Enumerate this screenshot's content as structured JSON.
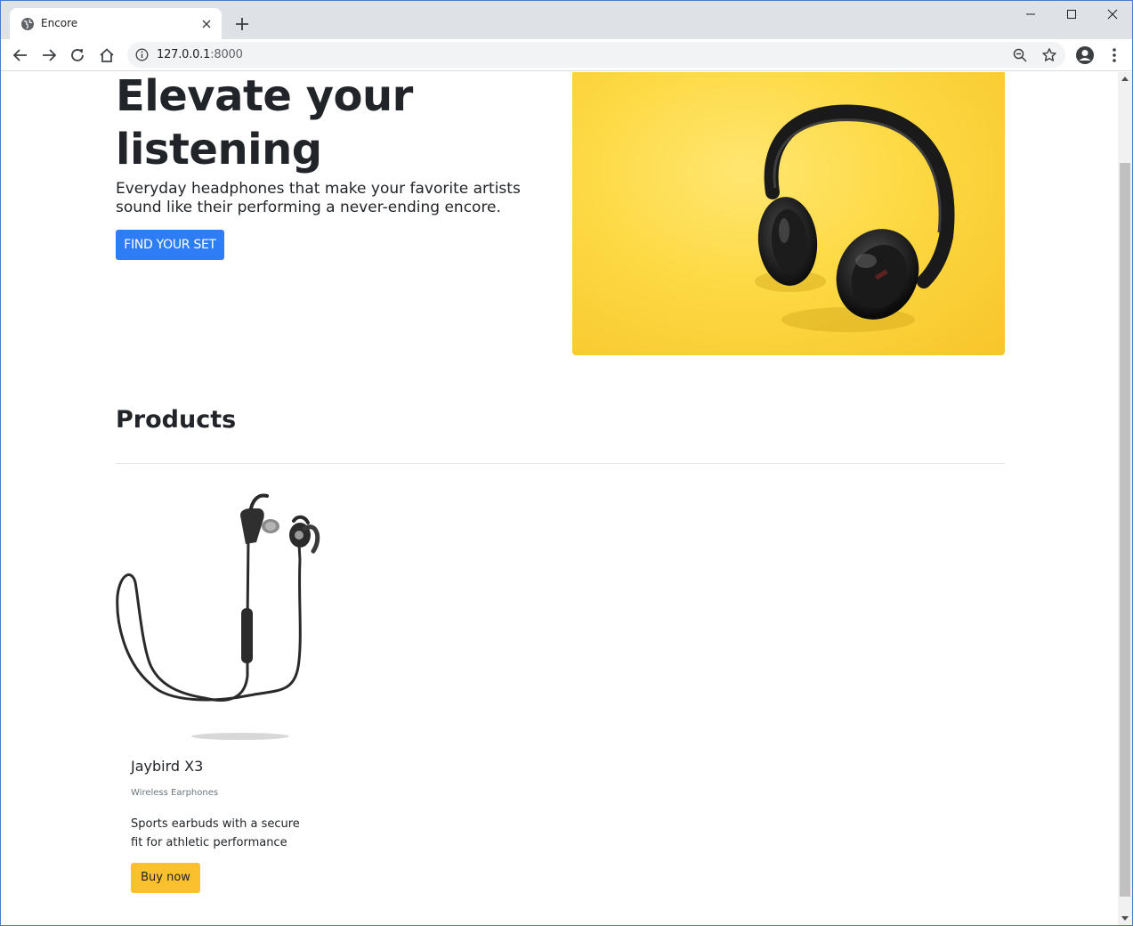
{
  "browser": {
    "tab_title": "Encore",
    "url_host": "127.0.0.1",
    "url_port": ":8000"
  },
  "hero": {
    "title": "Elevate your listening",
    "lead": "Everyday headphones that make your favorite artists sound like their performing a never-ending encore.",
    "cta_label": "FIND YOUR SET"
  },
  "products": {
    "section_title": "Products",
    "items": [
      {
        "name": "Jaybird X3",
        "subtitle": "Wireless Earphones",
        "description": "Sports earbuds with a secure fit for athletic performance",
        "button_label": "Buy now"
      }
    ]
  },
  "colors": {
    "primary": "#2e7cf6",
    "warning": "#fbc02d",
    "hero_bg": "#fdd943"
  }
}
